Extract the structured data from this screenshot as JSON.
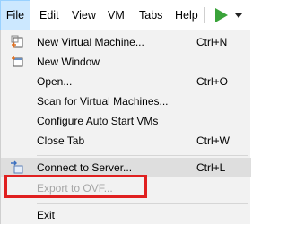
{
  "menubar": {
    "items": [
      "File",
      "Edit",
      "View",
      "VM",
      "Tabs",
      "Help"
    ]
  },
  "file_menu": {
    "items": [
      {
        "label": "New Virtual Machine...",
        "shortcut": "Ctrl+N"
      },
      {
        "label": "New Window",
        "shortcut": ""
      },
      {
        "label": "Open...",
        "shortcut": "Ctrl+O"
      },
      {
        "label": "Scan for Virtual Machines...",
        "shortcut": ""
      },
      {
        "label": "Configure Auto Start VMs",
        "shortcut": ""
      },
      {
        "label": "Close Tab",
        "shortcut": "Ctrl+W"
      },
      {
        "label": "Connect to Server...",
        "shortcut": "Ctrl+L"
      },
      {
        "label": "Export to OVF...",
        "shortcut": "",
        "disabled": true
      },
      {
        "label": "Exit",
        "shortcut": ""
      }
    ]
  },
  "colors": {
    "highlight_box": "#e02020",
    "play": "#3aa33a",
    "menu_bg": "#f2f2f2"
  }
}
